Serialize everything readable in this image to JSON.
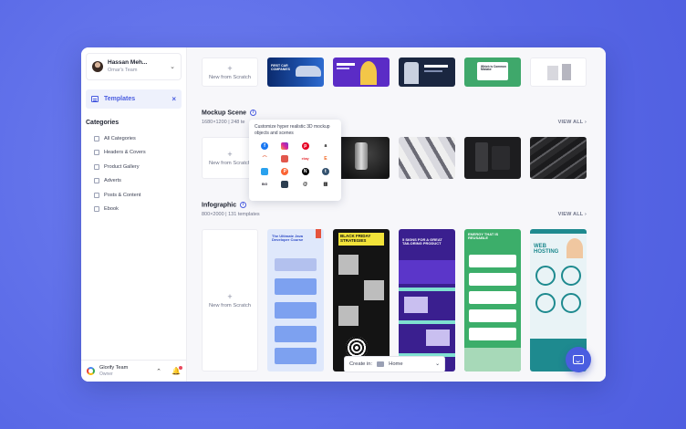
{
  "user": {
    "name": "Hassan Meh...",
    "team": "Omar's Team"
  },
  "nav": {
    "templates_label": "Templates"
  },
  "categories": {
    "title": "Categories",
    "items": [
      "All Categories",
      "Headers & Covers",
      "Product Gallery",
      "Adverts",
      "Posts & Content",
      "Ebook"
    ]
  },
  "footer": {
    "team_name": "Glorify Team",
    "team_role": "Owner"
  },
  "new_from_scratch": "New from Scratch",
  "mockup": {
    "title": "Mockup Scene",
    "dims": "1680×1200 | 248 te",
    "view_all": "VIEW ALL"
  },
  "infographic": {
    "title": "Infographic",
    "dims": "800×2000 | 131 templates",
    "view_all": "VIEW ALL"
  },
  "tooltip": {
    "text": "Customize hyper realistic 3D mockup objects and scenes",
    "brands": [
      "facebook",
      "instagram",
      "pinterest",
      "amazon",
      "shopify",
      "red-square",
      "ebay",
      "etsy",
      "linkedin",
      "producthunt",
      "notion",
      "tumblr",
      "bigcommerce",
      "gallery",
      "threads",
      "medium"
    ]
  },
  "create_bar": {
    "label": "Create in:",
    "value": "Home"
  },
  "thumb_text": {
    "t1": "FIRST CAR COMPANIES",
    "t4": "Which is Common Mistake",
    "info1": "The Ultimate Java Developer Course",
    "info2": "BLACK FRIDAY STRATEGIES",
    "info3": "5 SIGNS FOR A GREAT TAILORING PRODUCT",
    "info4": "ENERGY THAT IS REUSABLE",
    "info5": "WEB HOSTING"
  },
  "colors": {
    "accent": "#4a5de0",
    "background": "#5868e6"
  }
}
